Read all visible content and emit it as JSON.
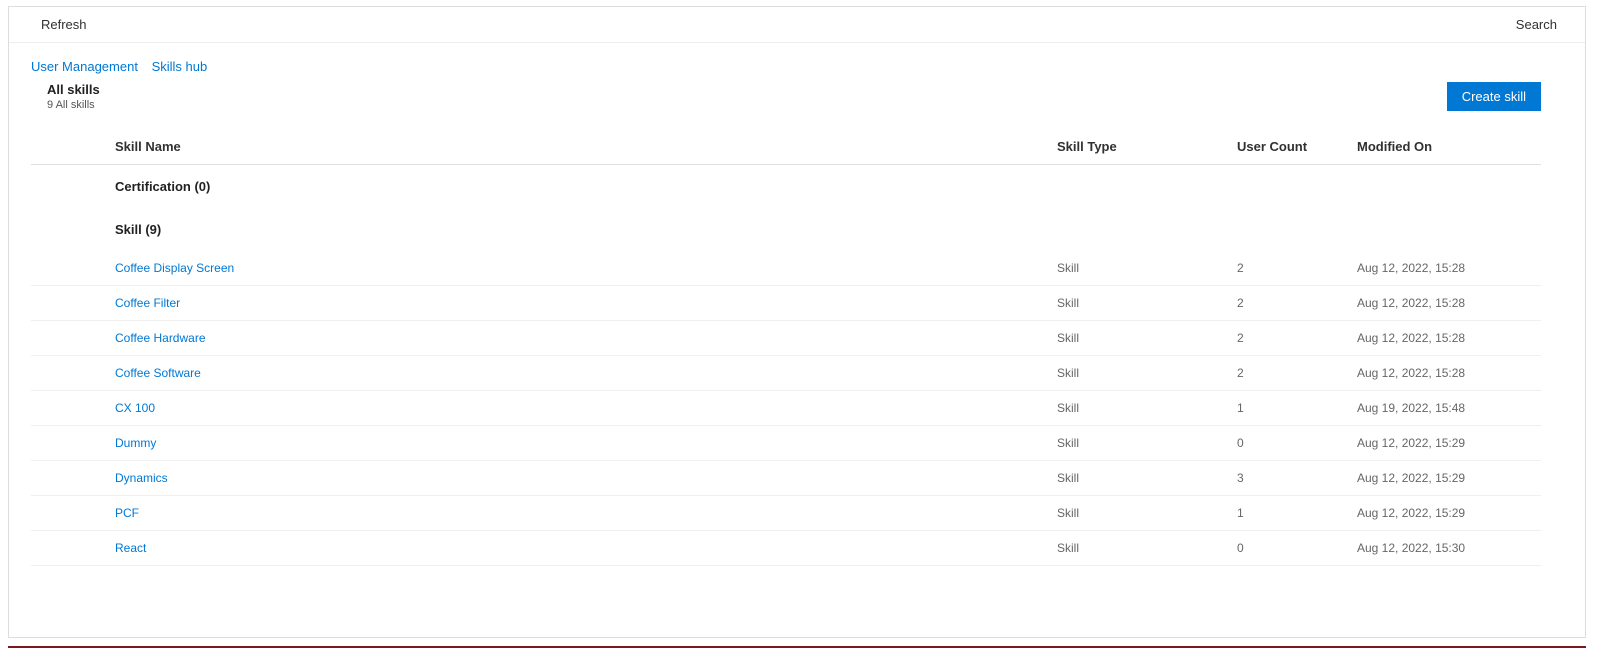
{
  "toolbar": {
    "refresh": "Refresh",
    "search": "Search"
  },
  "breadcrumb": {
    "items": [
      {
        "label": "User Management"
      },
      {
        "label": "Skills hub"
      }
    ]
  },
  "header": {
    "title": "All skills",
    "subtitle": "9 All skills",
    "create_button": "Create skill"
  },
  "columns": {
    "name": "Skill Name",
    "type": "Skill Type",
    "count": "User Count",
    "modified": "Modified On"
  },
  "groups": [
    {
      "label": "Certification (0)",
      "rows": []
    },
    {
      "label": "Skill (9)",
      "rows": [
        {
          "name": "Coffee Display Screen",
          "type": "Skill",
          "count": "2",
          "modified": "Aug 12, 2022, 15:28"
        },
        {
          "name": "Coffee Filter",
          "type": "Skill",
          "count": "2",
          "modified": "Aug 12, 2022, 15:28"
        },
        {
          "name": "Coffee Hardware",
          "type": "Skill",
          "count": "2",
          "modified": "Aug 12, 2022, 15:28"
        },
        {
          "name": "Coffee Software",
          "type": "Skill",
          "count": "2",
          "modified": "Aug 12, 2022, 15:28"
        },
        {
          "name": "CX 100",
          "type": "Skill",
          "count": "1",
          "modified": "Aug 19, 2022, 15:48"
        },
        {
          "name": "Dummy",
          "type": "Skill",
          "count": "0",
          "modified": "Aug 12, 2022, 15:29"
        },
        {
          "name": "Dynamics",
          "type": "Skill",
          "count": "3",
          "modified": "Aug 12, 2022, 15:29"
        },
        {
          "name": "PCF",
          "type": "Skill",
          "count": "1",
          "modified": "Aug 12, 2022, 15:29"
        },
        {
          "name": "React",
          "type": "Skill",
          "count": "0",
          "modified": "Aug 12, 2022, 15:30"
        }
      ]
    }
  ]
}
